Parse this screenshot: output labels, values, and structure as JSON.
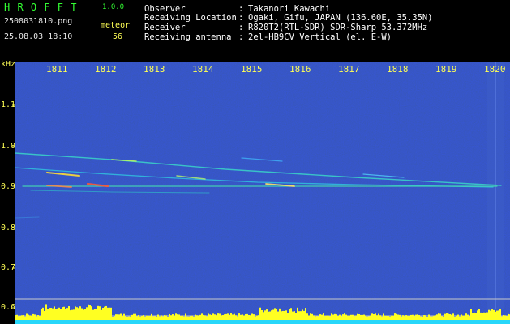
{
  "app": {
    "name": "H R O F F T",
    "version": "1.0.0"
  },
  "file": {
    "name": "2508031810.png",
    "datetime": "25.08.03 18:10"
  },
  "meteor": {
    "label": "meteor",
    "count": "56"
  },
  "info": [
    {
      "key": "Observer",
      "sep": ":",
      "value": "Takanori Kawachi"
    },
    {
      "key": "Receiving Location",
      "sep": ":",
      "value": "Ogaki, Gifu, JAPAN (136.60E, 35.35N)"
    },
    {
      "key": "Receiver",
      "sep": ":",
      "value": "R820T2(RTL-SDR) SDR-Sharp 53.372MHz"
    },
    {
      "key": "Receiving antenna",
      "sep": ":",
      "value": "2el-HB9CV Vertical (el. E-W)"
    }
  ],
  "y_axis": {
    "unit": "kHz",
    "ticks": [
      "1.1",
      "1.0",
      "0.9",
      "0.8",
      "0.7",
      "0.6"
    ]
  },
  "time_axis": {
    "ticks": [
      "1811",
      "1812",
      "1813",
      "1814",
      "1815",
      "1816",
      "1817",
      "1818",
      "1819",
      "1820"
    ]
  },
  "colors": {
    "background": "#000000",
    "spectrum": "#0a1a6e",
    "title": "#33ff33",
    "axis": "#ffff55",
    "text": "#ffffff"
  }
}
